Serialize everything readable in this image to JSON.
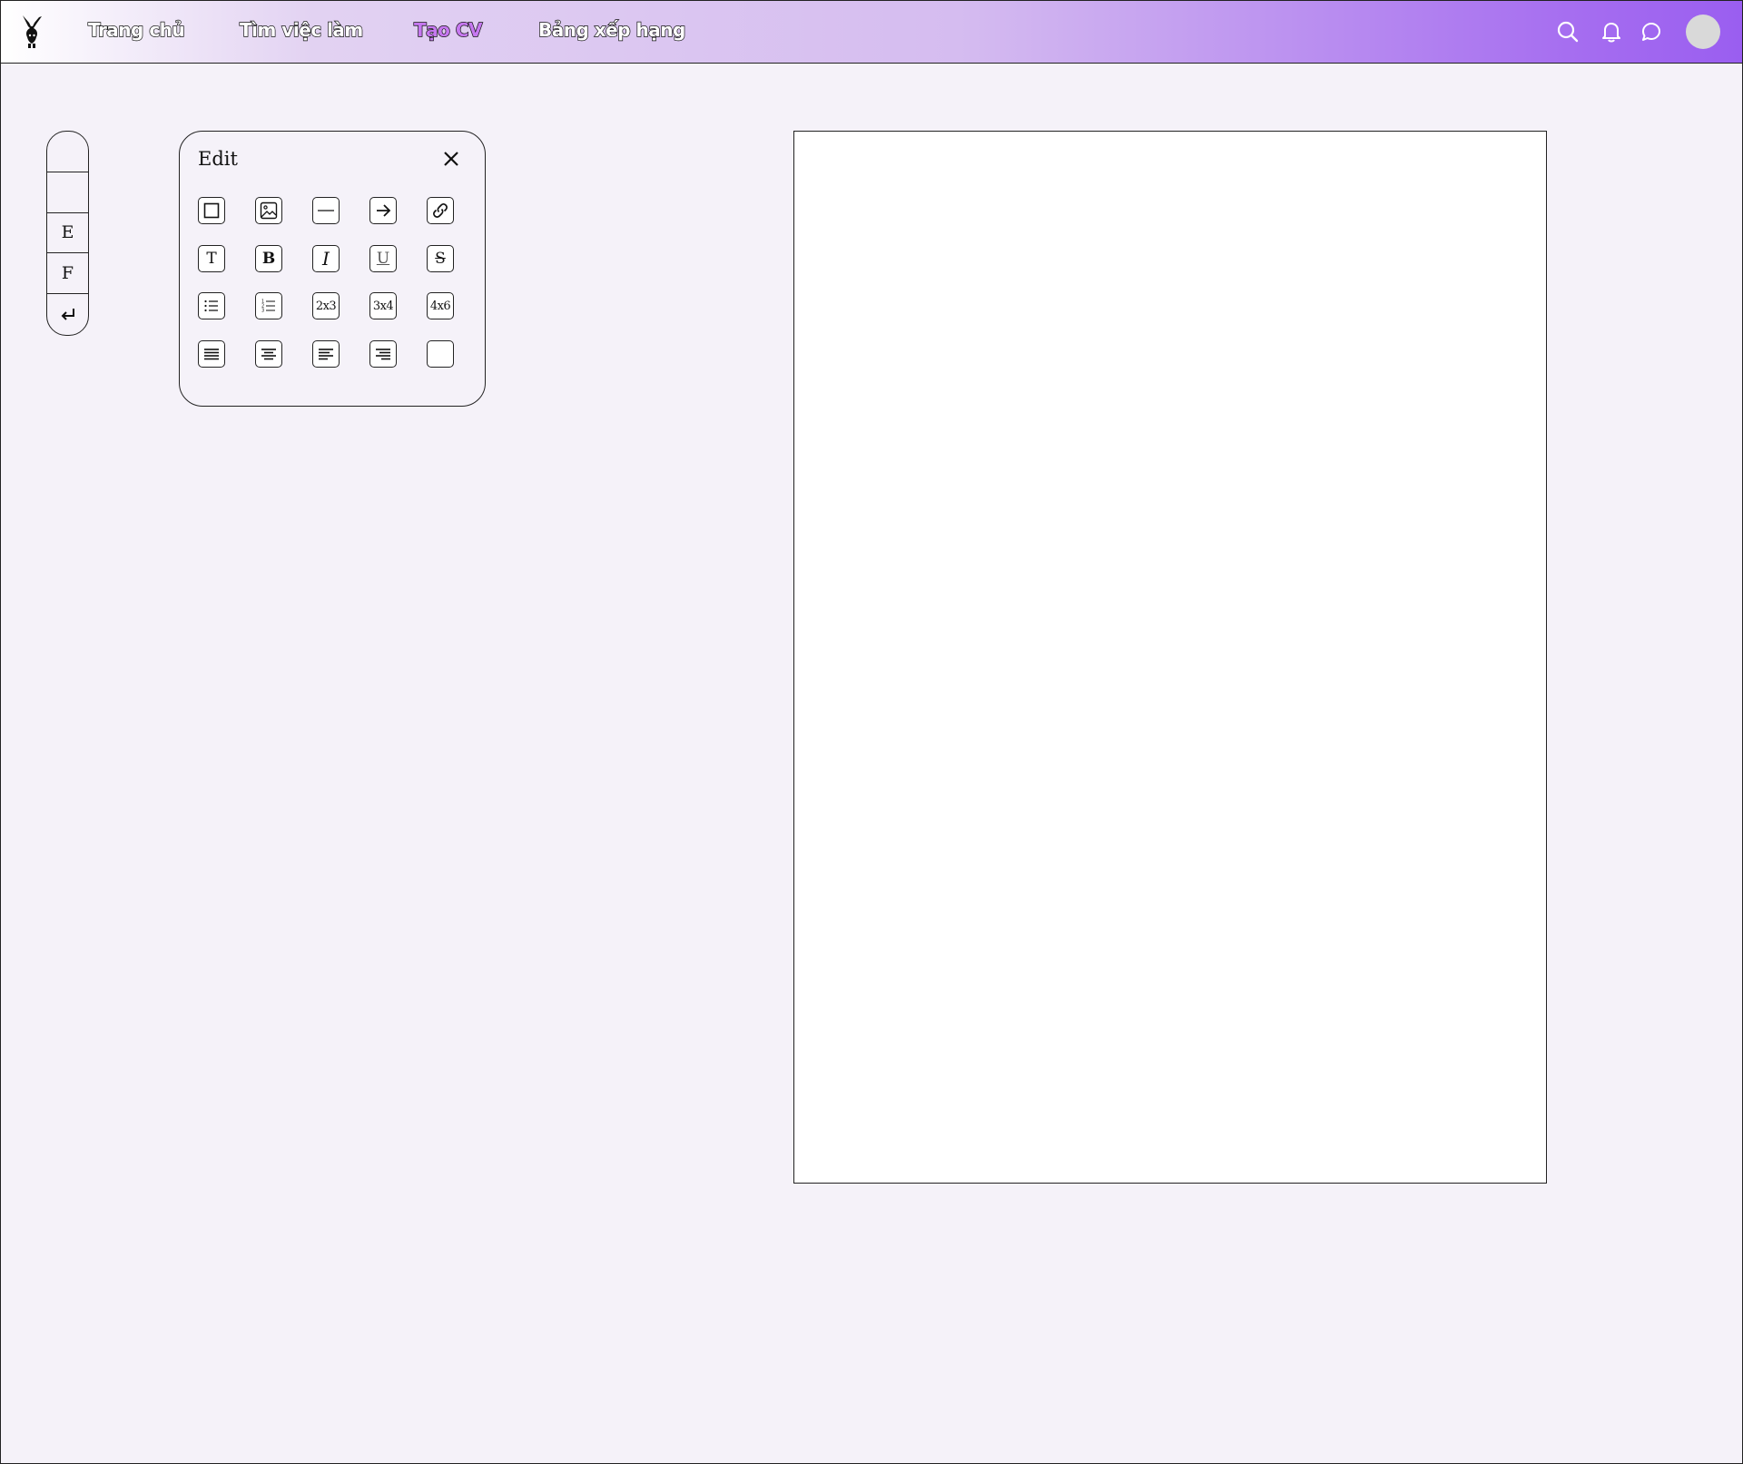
{
  "header": {
    "nav": [
      "Trang chủ",
      "Tìm việc làm",
      "Tạo CV",
      "Bảng xếp hạng"
    ],
    "active_nav": "Tạo CV",
    "icons": [
      "search-icon",
      "bell-icon",
      "chat-icon"
    ],
    "accent_color": "#9a5ef0",
    "active_color": "#c678f0"
  },
  "sidebar": {
    "items": [
      "",
      "",
      "E",
      "F",
      "return-icon"
    ]
  },
  "edit_panel": {
    "title": "Edit",
    "tools": [
      [
        "square-icon",
        "image-icon",
        "line-icon",
        "arrow-right-icon",
        "link-icon"
      ],
      [
        "T",
        "B",
        "I",
        "U",
        "S"
      ],
      [
        "bullet-list-icon",
        "numbered-list-icon",
        "2x3",
        "3x4",
        "4x6"
      ],
      [
        "align-justify-icon",
        "align-center-icon",
        "align-left-icon",
        "align-right-icon",
        "blank-icon"
      ]
    ]
  }
}
